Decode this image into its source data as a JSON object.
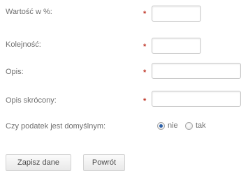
{
  "form": {
    "fields": [
      {
        "label": "Wartość w %:",
        "value": ""
      },
      {
        "label": "Kolejność:",
        "value": ""
      },
      {
        "label": "Opis:",
        "value": ""
      },
      {
        "label": "Opis skrócony:",
        "value": ""
      }
    ],
    "required_marker": "*",
    "default_question": {
      "label": "Czy podatek jest domyślnym:",
      "options": [
        "nie",
        "tak"
      ],
      "selected": "nie"
    },
    "buttons": {
      "save": "Zapisz dane",
      "back": "Powrót"
    }
  },
  "colors": {
    "required": "#c0392b",
    "radio_selected": "#2a5fa8"
  }
}
